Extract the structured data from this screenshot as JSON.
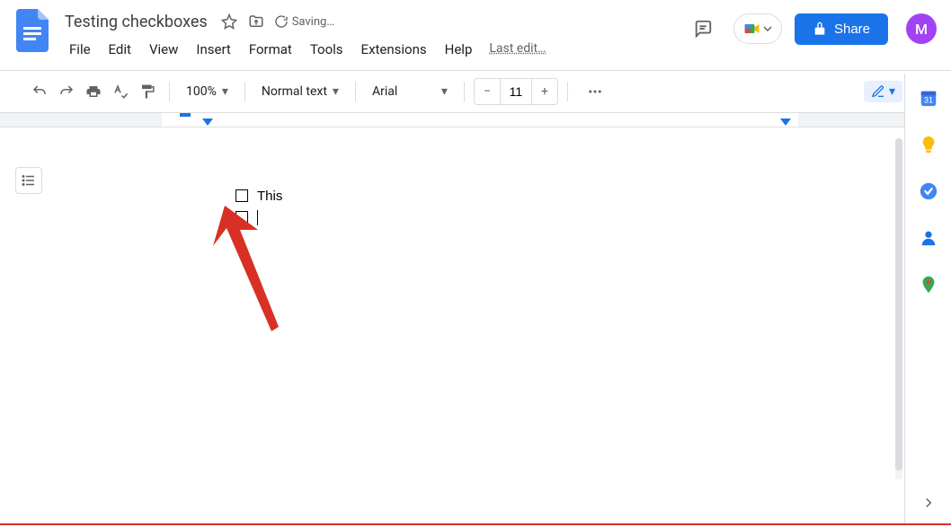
{
  "header": {
    "doc_title": "Testing checkboxes",
    "saving_text": "Saving…",
    "menus": [
      "File",
      "Edit",
      "View",
      "Insert",
      "Format",
      "Tools",
      "Extensions",
      "Help"
    ],
    "last_edit": "Last edit…",
    "share_label": "Share",
    "avatar_letter": "M"
  },
  "toolbar": {
    "zoom": "100%",
    "style": "Normal text",
    "font": "Arial",
    "font_size": "11"
  },
  "document": {
    "items": [
      {
        "text": "This",
        "checked": false
      },
      {
        "text": "",
        "checked": false
      }
    ]
  },
  "sidepanel": {
    "calendar_day": "31"
  }
}
